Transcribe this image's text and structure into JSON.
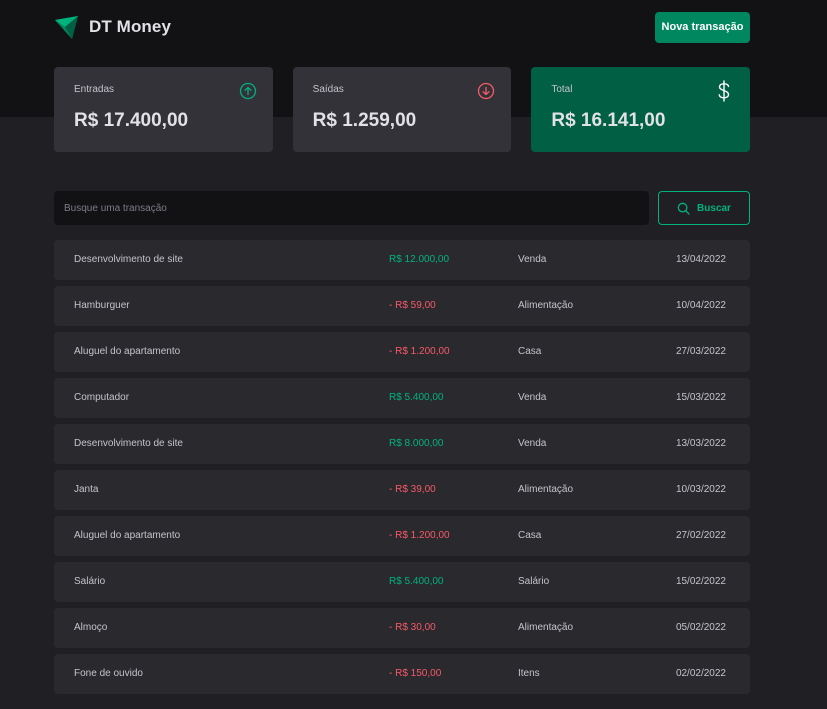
{
  "header": {
    "brand_name": "DT Money",
    "logo_icon": "triangle-logo-icon",
    "new_transaction_label": "Nova transação"
  },
  "summary": {
    "income": {
      "label": "Entradas",
      "value": "R$ 17.400,00",
      "icon": "arrow-circle-up-icon",
      "icon_color": "#00B37E"
    },
    "outcome": {
      "label": "Saídas",
      "value": "R$ 1.259,00",
      "icon": "arrow-circle-down-icon",
      "icon_color": "#F75A68"
    },
    "total": {
      "label": "Total",
      "value": "R$ 16.141,00",
      "icon": "dollar-icon",
      "background": "#015F43"
    }
  },
  "search": {
    "placeholder": "Busque uma transação",
    "button_label": "Buscar"
  },
  "transactions": [
    {
      "description": "Desenvolvimento de site",
      "amount": "R$ 12.000,00",
      "type": "income",
      "category": "Venda",
      "date": "13/04/2022"
    },
    {
      "description": "Hamburguer",
      "amount": "- R$ 59,00",
      "type": "outcome",
      "category": "Alimentação",
      "date": "10/04/2022"
    },
    {
      "description": "Aluguel do apartamento",
      "amount": "- R$ 1.200,00",
      "type": "outcome",
      "category": "Casa",
      "date": "27/03/2022"
    },
    {
      "description": "Computador",
      "amount": "R$ 5.400,00",
      "type": "income",
      "category": "Venda",
      "date": "15/03/2022"
    },
    {
      "description": "Desenvolvimento de site",
      "amount": "R$ 8.000,00",
      "type": "income",
      "category": "Venda",
      "date": "13/03/2022"
    },
    {
      "description": "Janta",
      "amount": "- R$ 39,00",
      "type": "outcome",
      "category": "Alimentação",
      "date": "10/03/2022"
    },
    {
      "description": "Aluguel do apartamento",
      "amount": "- R$ 1.200,00",
      "type": "outcome",
      "category": "Casa",
      "date": "27/02/2022"
    },
    {
      "description": "Salário",
      "amount": "R$ 5.400,00",
      "type": "income",
      "category": "Salário",
      "date": "15/02/2022"
    },
    {
      "description": "Almoço",
      "amount": "- R$ 30,00",
      "type": "outcome",
      "category": "Alimentação",
      "date": "05/02/2022"
    },
    {
      "description": "Fone de ouvido",
      "amount": "- R$ 150,00",
      "type": "outcome",
      "category": "Itens",
      "date": "02/02/2022"
    }
  ],
  "colors": {
    "brand_green": "#00875F",
    "income": "#00B37E",
    "outcome": "#F75A68",
    "background": "#202024",
    "header": "#121214",
    "card": "#323238",
    "row": "#29292E"
  }
}
